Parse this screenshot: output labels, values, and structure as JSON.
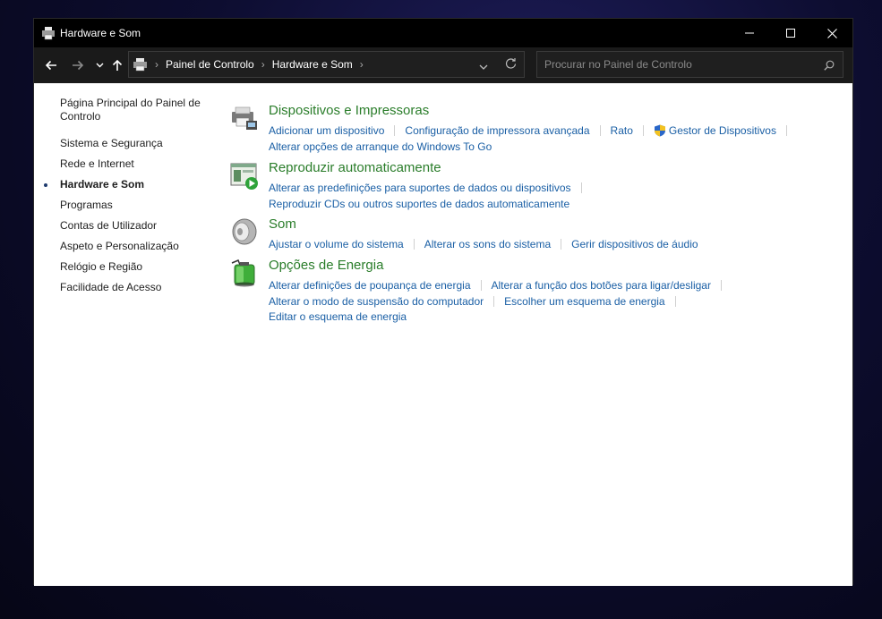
{
  "window": {
    "title": "Hardware e Som"
  },
  "address_bar": {
    "crumbs": [
      "Painel de Controlo",
      "Hardware e Som"
    ]
  },
  "search": {
    "placeholder": "Procurar no Painel de Controlo"
  },
  "sidebar": {
    "home": "Página Principal do Painel de Controlo",
    "items": [
      {
        "label": "Sistema e Segurança"
      },
      {
        "label": "Rede e Internet"
      },
      {
        "label": "Hardware e Som",
        "active": true
      },
      {
        "label": "Programas"
      },
      {
        "label": "Contas de Utilizador"
      },
      {
        "label": "Aspeto e Personalização"
      },
      {
        "label": "Relógio e Região"
      },
      {
        "label": "Facilidade de Acesso"
      }
    ]
  },
  "categories": [
    {
      "title": "Dispositivos e Impressoras",
      "icon": "printer-icon",
      "rows": [
        [
          "Adicionar um dispositivo",
          "Configuração de impressora avançada",
          "Rato",
          "Gestor de Dispositivos"
        ],
        [
          "Alterar opções de arranque do Windows To Go"
        ]
      ]
    },
    {
      "title": "Reproduzir automaticamente",
      "icon": "autoplay-icon",
      "rows": [
        [
          "Alterar as predefinições para suportes de dados ou dispositivos"
        ],
        [
          "Reproduzir CDs ou outros suportes de dados automaticamente"
        ]
      ]
    },
    {
      "title": "Som",
      "icon": "speaker-icon",
      "rows": [
        [
          "Ajustar o volume do sistema",
          "Alterar os sons do sistema",
          "Gerir dispositivos de áudio"
        ]
      ]
    },
    {
      "title": "Opções de Energia",
      "icon": "battery-icon",
      "rows": [
        [
          "Alterar definições de poupança de energia",
          "Alterar a função dos botões para ligar/desligar"
        ],
        [
          "Alterar o modo de suspensão do computador",
          "Escolher um esquema de energia"
        ],
        [
          "Editar o esquema de energia"
        ]
      ]
    }
  ]
}
